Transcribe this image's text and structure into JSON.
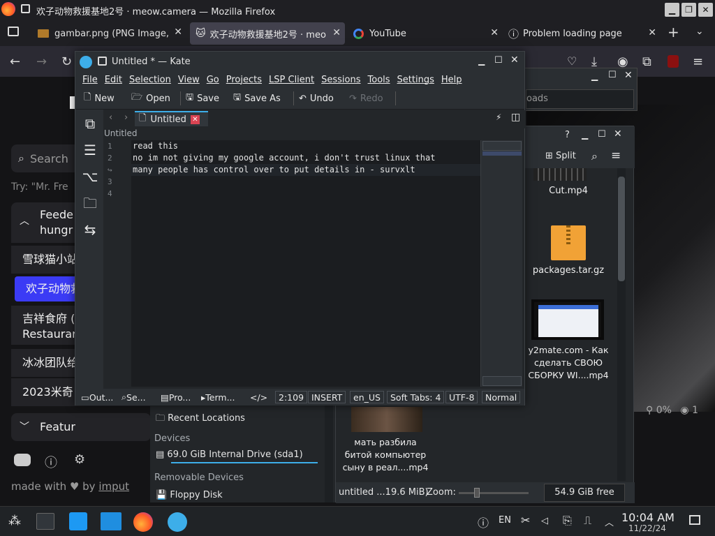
{
  "firefox": {
    "window_title": "欢子动物救援基地2号 · meow.camera — Mozilla Firefox",
    "tabs": [
      {
        "label": "gambar.png (PNG Image, ",
        "icon": "image-file-icon"
      },
      {
        "label": "欢子动物救援基地2号 · meo",
        "icon": "cat-icon",
        "active": true
      },
      {
        "label": "YouTube",
        "icon": "google-g-icon"
      },
      {
        "label": "Problem loading page",
        "icon": "info-circle-icon"
      }
    ]
  },
  "webpage": {
    "search_placeholder": "Search",
    "try_text": "Try: \"Mr. Fre",
    "feeder_heading_1": "Feede",
    "feeder_heading_2": "hungr",
    "items": [
      "雪球猫小站",
      "欢子动物救",
      "吉祥食府 (",
      "Restaurar",
      "冰冰团队给",
      "2023米奇"
    ],
    "features_label": "Featur",
    "made_with": "made with ",
    "by": " by ",
    "imput": "imput",
    "stats_percent": "0%",
    "stats_views": "1"
  },
  "dolphin": {
    "search_hint": "oads",
    "split_label": "Split",
    "files": [
      {
        "name": "Cut.mp4"
      },
      {
        "name": "packages.tar.gz"
      },
      {
        "name": "y2mate.com - Как сделать СВОЮ СБОРКУ WI....mp4"
      },
      {
        "name": "мать разбила битой компьютер сыну в реал....mp4"
      }
    ],
    "status_left": "untitled ...19.6 MiB)",
    "zoom_label": "Zoom:",
    "free_space": "54.9 GiB free",
    "places": {
      "recent_locations": "Recent Locations",
      "devices_header": "Devices",
      "internal_drive": "69.0 GiB Internal Drive (sda1)",
      "removable_header": "Removable Devices",
      "floppy": "Floppy Disk"
    }
  },
  "kate": {
    "title": "Untitled * — Kate",
    "menu": [
      "File",
      "Edit",
      "Selection",
      "View",
      "Go",
      "Projects",
      "LSP Client",
      "Sessions",
      "Tools",
      "Settings",
      "Help"
    ],
    "toolbar": {
      "new": "New",
      "open": "Open",
      "save": "Save",
      "save_as": "Save As",
      "undo": "Undo",
      "redo": "Redo"
    },
    "doc_tab": "Untitled",
    "breadcrumb": "Untitled",
    "line_numbers": [
      "1",
      "2",
      "",
      "3",
      "4"
    ],
    "lines": [
      "read this",
      "no im not giving my google account, i don't trust linux that",
      "many people has control over to put details in - survxlt",
      "",
      ""
    ],
    "status": {
      "output": "Out...",
      "search": "Se...",
      "projects": "Pro...",
      "terminal": "Term...",
      "cursor": "2:109",
      "mode": "INSERT",
      "lang": "en_US",
      "tabs": "Soft Tabs: 4",
      "encoding": "UTF-8",
      "input_mode": "Normal"
    }
  },
  "taskbar": {
    "keyboard_layout": "EN",
    "time": "10:04 AM",
    "date": "11/22/24"
  },
  "colors": {
    "accent_blue": "#3daee9",
    "firefox_active_tab": "#42414d",
    "webpage_highlight": "#3b3bf5",
    "kate_bg": "#232629"
  }
}
